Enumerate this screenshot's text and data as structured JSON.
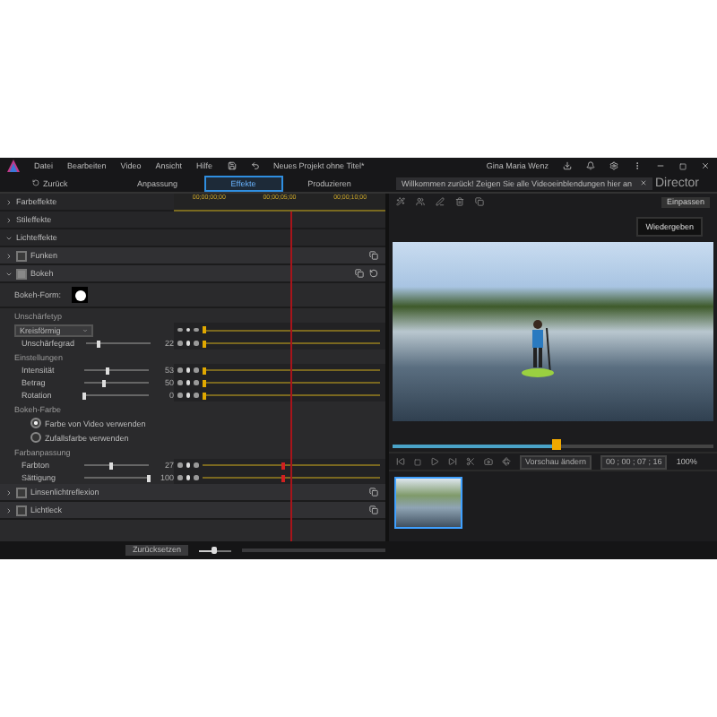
{
  "title_bar": {
    "menu": [
      "Datei",
      "Bearbeiten",
      "Video",
      "Ansicht",
      "Hilfe"
    ],
    "project_title": "Neues Projekt ohne Titel*",
    "user": "Gina Maria Wenz"
  },
  "nav": {
    "back": "Zurück",
    "tabs": [
      {
        "label": "Anpassung",
        "selected": false
      },
      {
        "label": "Effekte",
        "selected": true
      },
      {
        "label": "Produzieren",
        "selected": false
      }
    ],
    "notification": "Willkommen zurück! Zeigen Sie alle Videoeinblendungen hier an",
    "brand": "Director"
  },
  "ruler": [
    "00;00;00;00",
    "00;00;05;00",
    "00;00;10;00"
  ],
  "effects": [
    {
      "kind": "category",
      "label": "Farbeffekte",
      "expanded": false
    },
    {
      "kind": "category",
      "label": "Stileffekte",
      "expanded": false
    },
    {
      "kind": "category",
      "label": "Lichteffekte",
      "expanded": true
    },
    {
      "kind": "effect",
      "label": "Funken",
      "checked": false,
      "expanded": false
    },
    {
      "kind": "effect",
      "label": "Bokeh",
      "checked": true,
      "expanded": true
    },
    {
      "kind": "shape",
      "label": "Bokeh-Form:"
    },
    {
      "kind": "section",
      "label": "Unschärfetyp"
    },
    {
      "kind": "dropdown",
      "value": "Kreisförmig"
    },
    {
      "kind": "slider",
      "label": "Unschärfegrad",
      "level": 0.2,
      "reading": "22"
    },
    {
      "kind": "section",
      "label": "Einstellungen"
    },
    {
      "kind": "slider",
      "label": "Intensität",
      "level": 0.35,
      "reading": "53"
    },
    {
      "kind": "slider",
      "label": "Betrag",
      "level": 0.3,
      "reading": "50"
    },
    {
      "kind": "slider",
      "label": "Rotation",
      "level": 0,
      "reading": "0"
    },
    {
      "kind": "section",
      "label": "Bokeh-Farbe"
    },
    {
      "kind": "radio",
      "label": "Farbe von Video verwenden",
      "selected": true
    },
    {
      "kind": "radio",
      "label": "Zufallsfarbe verwenden",
      "selected": false
    },
    {
      "kind": "section",
      "label": "Farbanpassung"
    },
    {
      "kind": "slider",
      "label": "Farbton",
      "level": 0.42,
      "reading": "27"
    },
    {
      "kind": "slider",
      "label": "Sättigung",
      "level": 1,
      "reading": "100"
    },
    {
      "kind": "effect",
      "label": "Linsenlichtreflexion",
      "checked": false,
      "expanded": false
    },
    {
      "kind": "effect",
      "label": "Lichtleck",
      "checked": false,
      "expanded": false
    }
  ],
  "bottom_bar": {
    "reset": "Zurücksetzen",
    "zoom_slider": {
      "level": 0.45
    }
  },
  "preview": {
    "fit": "Einpassen",
    "play_hint": "Wiedergeben",
    "scrub": {
      "level": 0.51
    },
    "change_preview": "Vorschau ändern",
    "timecode": "00 ; 00 ; 07 ; 16",
    "zoom": "100%"
  },
  "clips": [
    {
      "selected": true
    }
  ]
}
